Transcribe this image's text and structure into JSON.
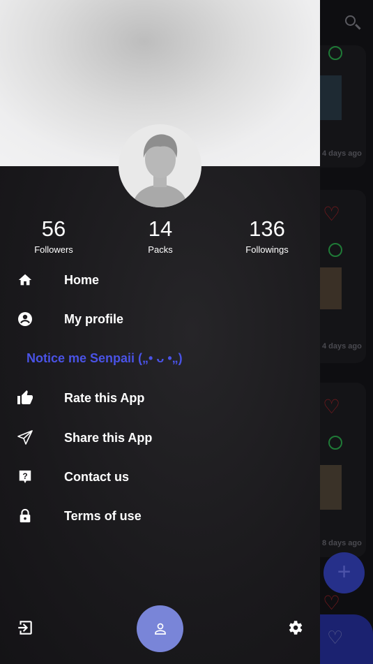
{
  "background_feed": {
    "timestamps": [
      "4 days ago",
      "4 days ago",
      "8 days ago"
    ]
  },
  "profile": {
    "stats": [
      {
        "value": "56",
        "label": "Followers"
      },
      {
        "value": "14",
        "label": "Packs"
      },
      {
        "value": "136",
        "label": "Followings"
      }
    ]
  },
  "menu": {
    "items": [
      {
        "label": "Home",
        "icon": "home-icon"
      },
      {
        "label": "My profile",
        "icon": "account-circle-icon"
      },
      {
        "label": "Rate this App",
        "icon": "thumb-up-icon"
      },
      {
        "label": "Share this App",
        "icon": "send-icon"
      },
      {
        "label": "Contact us",
        "icon": "help-icon"
      },
      {
        "label": "Terms of use",
        "icon": "lock-icon"
      }
    ],
    "notice": "Notice me Senpaii („• ᴗ •„)"
  },
  "colors": {
    "accent": "#4a53e6",
    "profile_button": "#7985d8",
    "drawer": "#1a191c"
  }
}
